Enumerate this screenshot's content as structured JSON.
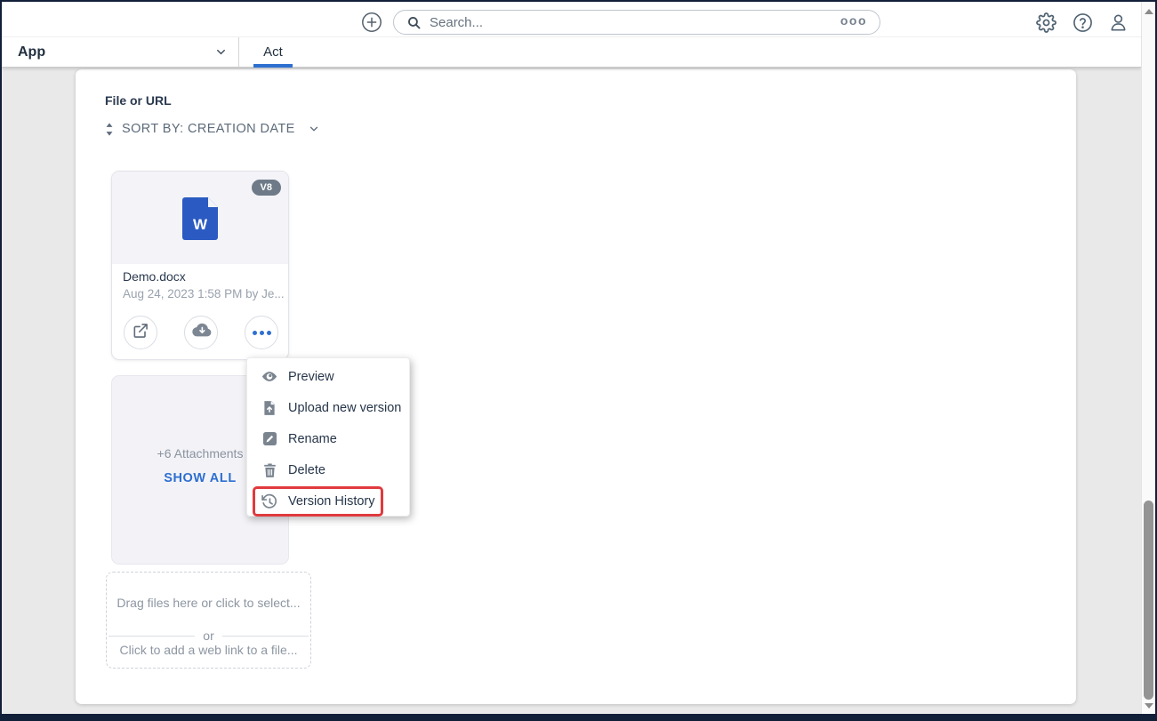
{
  "topbar": {
    "search_placeholder": "Search...",
    "search_more_label": "ooo"
  },
  "nav": {
    "app_label": "App",
    "tab_label": "Act"
  },
  "content": {
    "section_title": "File or URL",
    "sort": {
      "label": "SORT BY: CREATION DATE"
    },
    "file_card": {
      "version_badge": "V8",
      "file_type_letter": "W",
      "name": "Demo.docx",
      "meta": "Aug 24, 2023 1:58 PM by Je..."
    },
    "attachments_card": {
      "count_label": "+6 Attachments",
      "show_all_label": "SHOW ALL"
    },
    "dropzone": {
      "drag_label": "Drag files here or click to select...",
      "or_label": "or",
      "link_label": "Click to add a web link to a file..."
    }
  },
  "context_menu": {
    "items": [
      {
        "label": "Preview",
        "icon": "eye-icon"
      },
      {
        "label": "Upload new version",
        "icon": "upload-file-icon"
      },
      {
        "label": "Rename",
        "icon": "pencil-icon"
      },
      {
        "label": "Delete",
        "icon": "trash-icon"
      },
      {
        "label": "Version History",
        "icon": "history-icon",
        "highlighted": true
      }
    ]
  },
  "colors": {
    "accent_blue": "#2e6fd0",
    "word_blue": "#2b5ac2",
    "badge_gray": "#6e7a88",
    "highlight_red": "#e03a3e",
    "frame_navy": "#121f38"
  }
}
